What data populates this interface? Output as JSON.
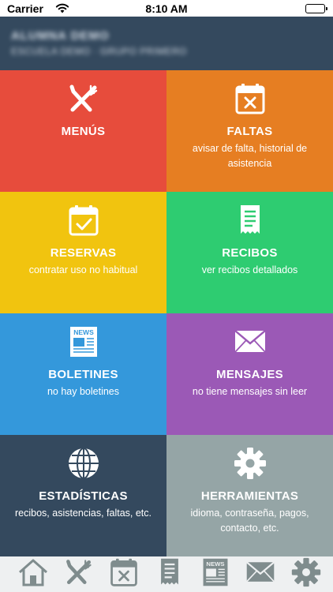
{
  "status_bar": {
    "carrier": "Carrier",
    "time": "8:10 AM",
    "icons": [
      "wifi-icon",
      "battery-icon"
    ]
  },
  "header": {
    "user_name": "ALUMNA DEMO",
    "user_details": "ESCUELA DEMO · GRUPO PRIMERO"
  },
  "tiles": [
    {
      "id": "menus",
      "title": "MENÚS",
      "description": "",
      "icon": "cutlery-icon",
      "color": "#e74c3c"
    },
    {
      "id": "faltas",
      "title": "FALTAS",
      "description": "avisar de falta, historial de asistencia",
      "icon": "calendar-cross-icon",
      "color": "#e67e22"
    },
    {
      "id": "reservas",
      "title": "RESERVAS",
      "description": "contratar uso no habitual",
      "icon": "calendar-check-icon",
      "color": "#f1c40f"
    },
    {
      "id": "recibos",
      "title": "RECIBOS",
      "description": "ver recibos detallados",
      "icon": "receipt-icon",
      "color": "#2ecc71"
    },
    {
      "id": "boletines",
      "title": "BOLETINES",
      "description": "no hay boletines",
      "icon": "newspaper-icon",
      "color": "#3498db"
    },
    {
      "id": "mensajes",
      "title": "MENSAJES",
      "description": "no tiene mensajes sin leer",
      "icon": "envelope-icon",
      "color": "#9b59b6"
    },
    {
      "id": "estadisticas",
      "title": "ESTADÍSTICAS",
      "description": "recibos, asistencias, faltas, etc.",
      "icon": "globe-icon",
      "color": "#34495e"
    },
    {
      "id": "herramientas",
      "title": "HERRAMIENTAS",
      "description": "idioma, contraseña, pagos, contacto, etc.",
      "icon": "gear-icon",
      "color": "#95a5a6"
    }
  ],
  "tabbar": {
    "icon_color": "#7f8c8d",
    "tabs": [
      "home-icon",
      "cutlery-icon",
      "calendar-cross-icon",
      "receipt-icon",
      "newspaper-icon",
      "envelope-icon",
      "gear-icon"
    ],
    "news_text": "NEWS"
  }
}
